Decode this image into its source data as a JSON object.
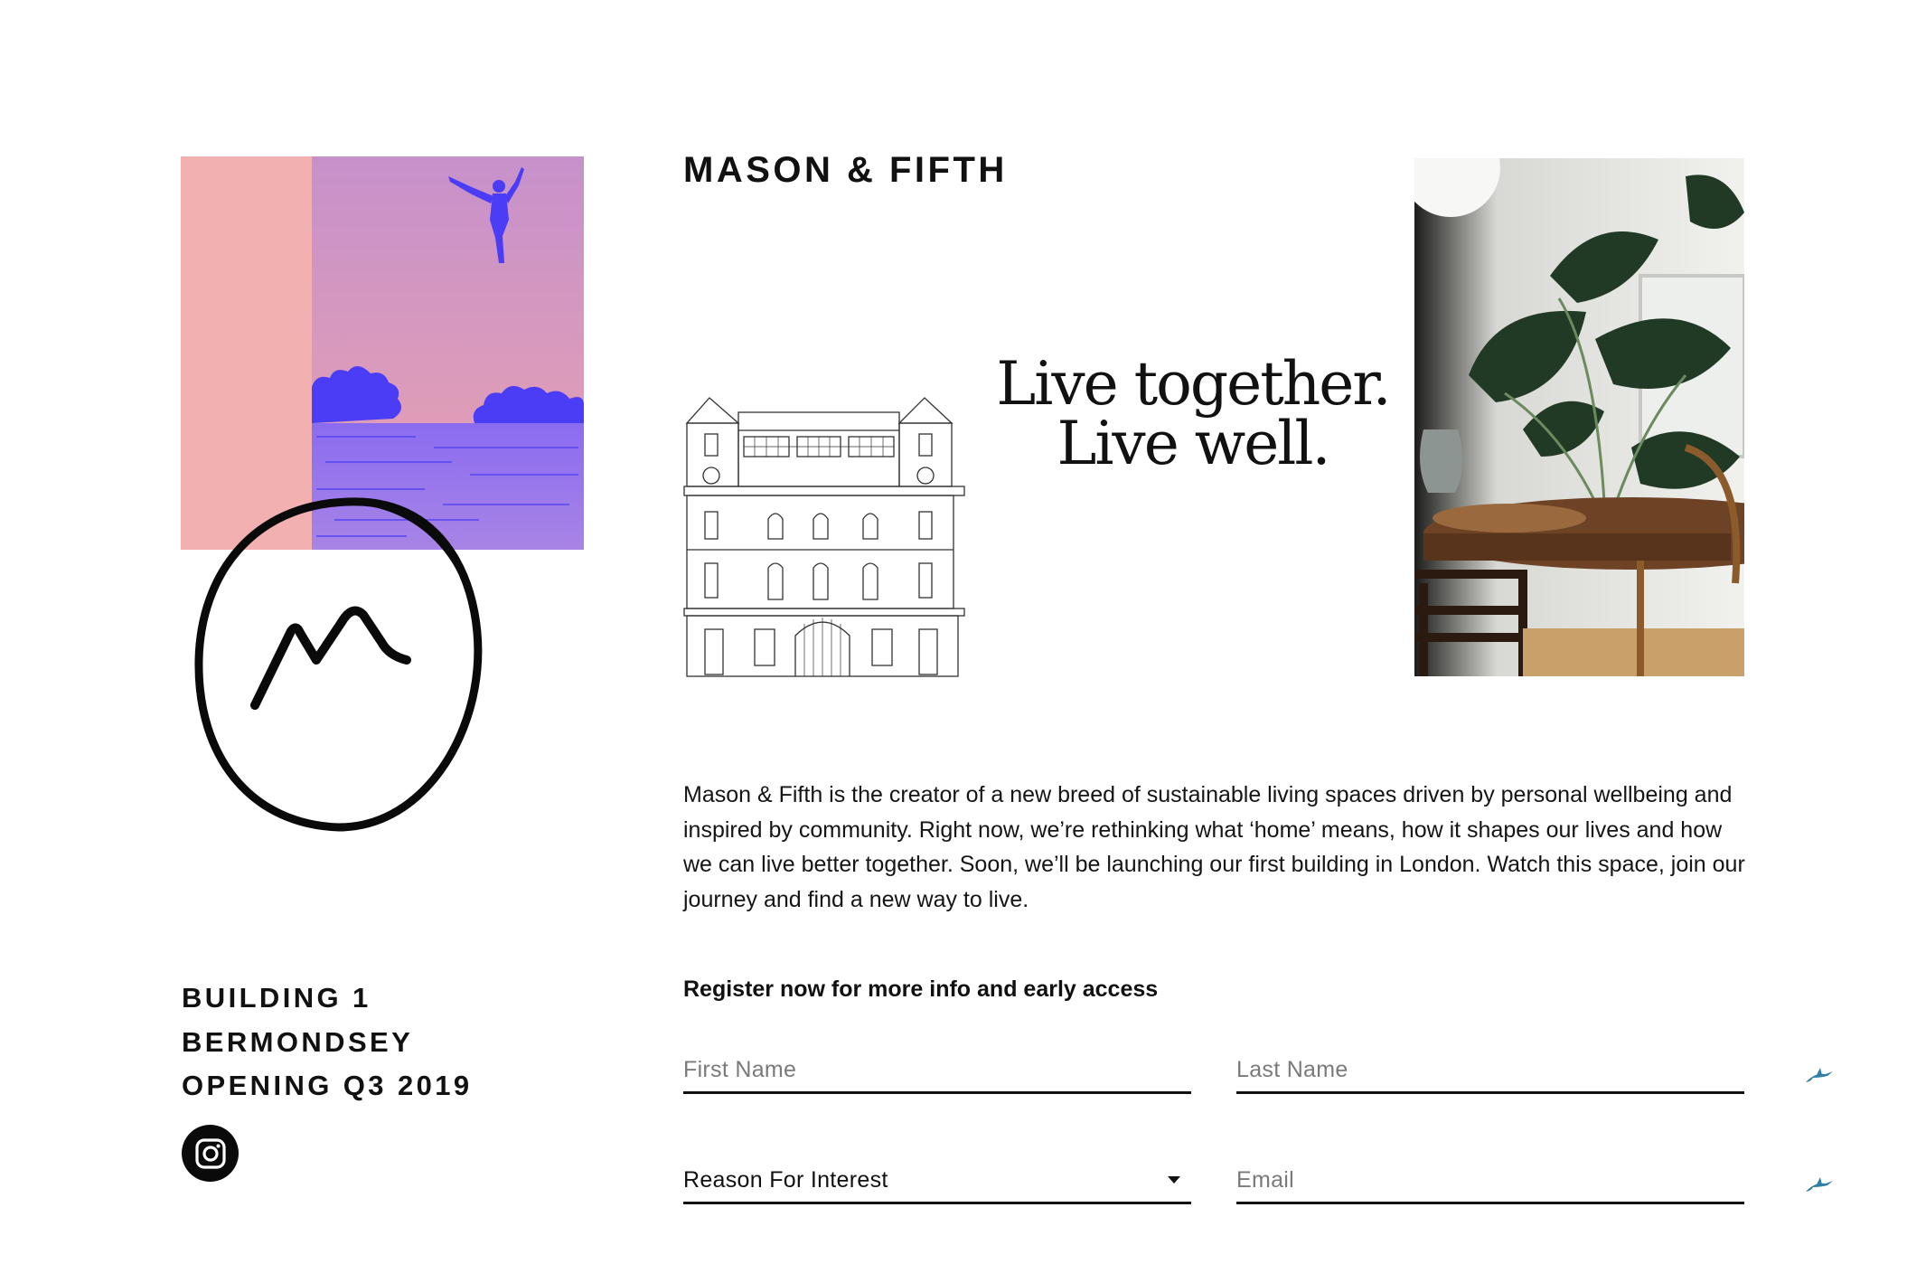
{
  "brand": {
    "title": "MASON & FIFTH"
  },
  "tagline": {
    "line1": "Live together.",
    "line2": "Live well."
  },
  "about": {
    "text": "Mason & Fifth is the creator of a new breed of sustainable living spaces driven by personal wellbeing and inspired by community. Right now, we’re rethinking what ‘home’ means, how it shapes our lives and how we can live better together. Soon, we’ll be launching our first building in London. Watch this space, join our journey and find a new way to live."
  },
  "building_info": {
    "line1": "BUILDING 1",
    "line2": "BERMONDSEY",
    "line3": "OPENING Q3 2019"
  },
  "register": {
    "heading": "Register now for more info and early access",
    "first_name_placeholder": "First Name",
    "last_name_placeholder": "Last Name",
    "reason_value": "Reason For Interest",
    "email_placeholder": "Email"
  },
  "icons": {
    "instagram": "instagram-icon",
    "logo": "mountain-circle-logo",
    "dropdown": "caret-down-icon",
    "side_marker": "bird-icon"
  },
  "colors": {
    "accent_blue": "#4b3cf5",
    "pink": "#f2b1b1",
    "lilac": "#c896c8",
    "text": "#111111"
  }
}
